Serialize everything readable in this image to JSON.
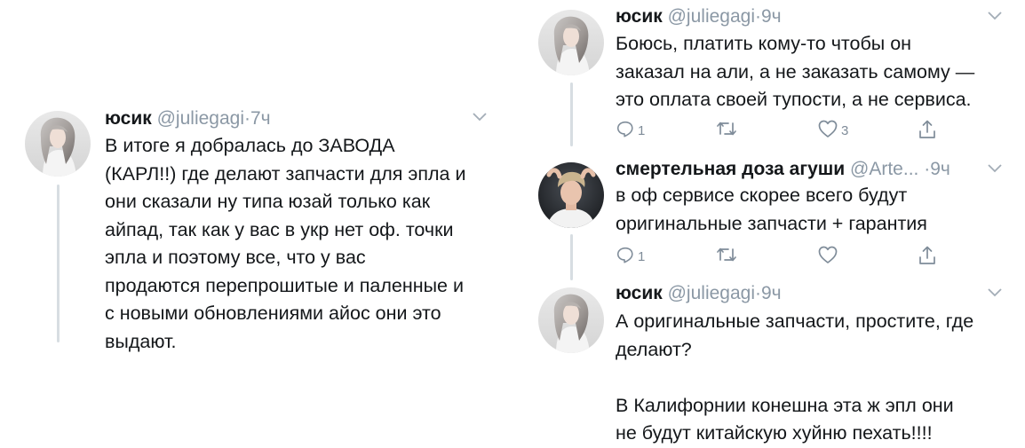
{
  "tweets": [
    {
      "name": "юсик",
      "handle": "@juliegagi",
      "dot": "·",
      "time": "7ч",
      "text": "В итоге я добралась до ЗАВОДА\n(КАРЛ!!) где делают запчасти для эпла и\nони сказали ну типа юзай только как\nайпад, так как у вас в укр нет оф. точки\nэпла и поэтому все, что у вас\nпродаются перепрошитые и паленные и\nс новыми обновлениями айос они это\nвыдают."
    },
    {
      "name": "юсик",
      "handle": "@juliegagi",
      "dot": "·",
      "time": "9ч",
      "text": "Боюсь, платить кому-то чтобы он\nзаказал на али, а не заказать самому —\nэто оплата своей тупости, а не сервиса.",
      "reply_count": "1",
      "retweet_count": "",
      "like_count": "3"
    },
    {
      "name": "смертельная доза агуши",
      "handle": "@Arte...",
      "dot": "·",
      "time": "9ч",
      "text": "в оф сервисе скорее всего будут\nоригинальные запчасти + гарантия",
      "reply_count": "1",
      "retweet_count": "",
      "like_count": ""
    },
    {
      "name": "юсик",
      "handle": "@juliegagi",
      "dot": "·",
      "time": "9ч",
      "text": "А оригинальные запчасти, простите, где\nделают?\n\nВ Калифорнии конешна эта ж эпл они\nне будут китайскую хуйню пехать!!!!"
    }
  ],
  "icons": {
    "chevron": "chevron-down-icon",
    "reply": "reply-icon",
    "retweet": "retweet-icon",
    "like": "heart-icon",
    "share": "share-icon"
  },
  "colors": {
    "text": "#14171a",
    "muted": "#8b98a5",
    "thread_line": "#d7dde2",
    "icon": "#7f8c99"
  }
}
